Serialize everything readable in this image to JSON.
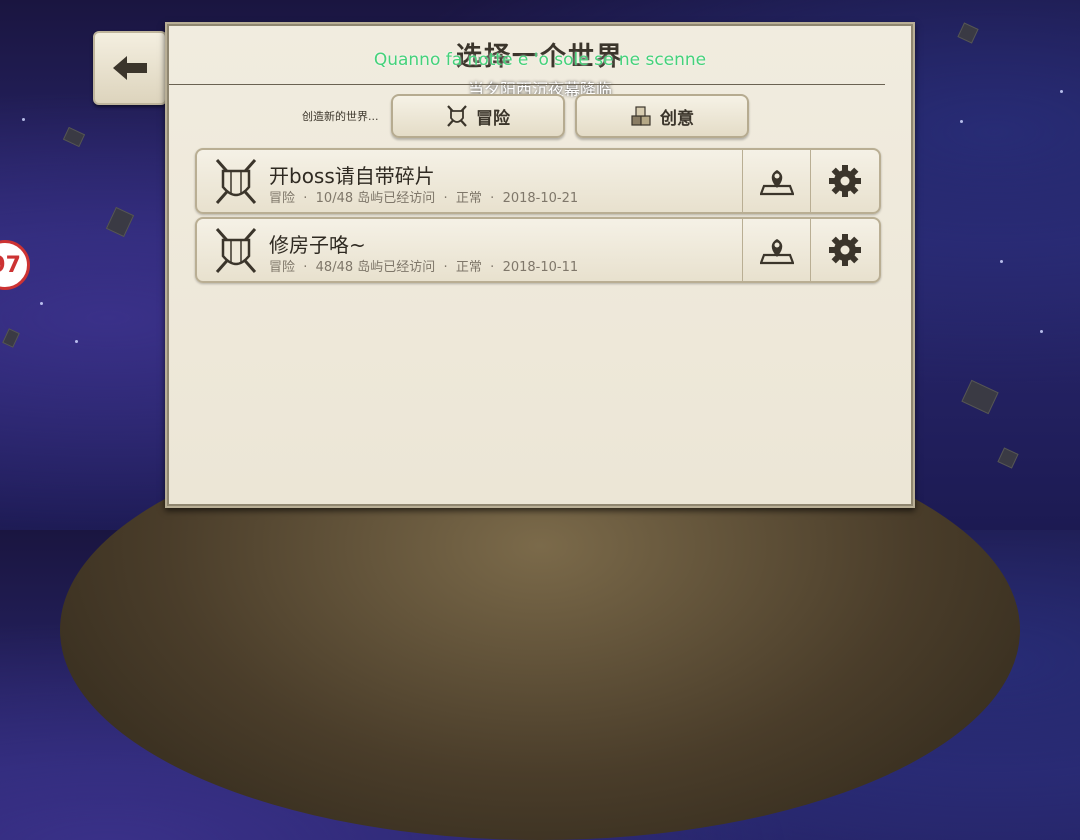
{
  "header": {
    "title": "选择一个世界",
    "subtitle_line1": "Quanno fa notte e 'o sole se ne scenne",
    "subtitle_line2": "当夕阳西沉夜幕降临"
  },
  "back_button": {
    "icon": "back-arrow-icon"
  },
  "badge": {
    "text": "97"
  },
  "create": {
    "label": "创造新的世界...",
    "adventure_label": "冒险",
    "creative_label": "创意"
  },
  "worlds": [
    {
      "name": "开boss请自带碎片",
      "meta": "冒险  ·  10/48 岛屿已经访问  ·  正常  ·  2018-10-21",
      "icon": "shield-swords-icon"
    },
    {
      "name": "修房子咯~",
      "meta": "冒险  ·  48/48 岛屿已经访问  ·  正常  ·  2018-10-11",
      "icon": "shield-swords-icon"
    }
  ],
  "colors": {
    "panel": "#ece6d6",
    "text": "#3b352b",
    "subtitle_green": "#45d27a",
    "accent_brown": "#4a3f30"
  }
}
